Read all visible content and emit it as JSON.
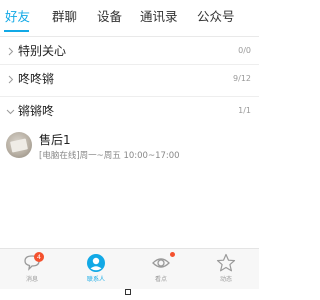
{
  "tabs": [
    {
      "label": "好友"
    },
    {
      "label": "群聊"
    },
    {
      "label": "设备"
    },
    {
      "label": "通讯录"
    },
    {
      "label": "公众号"
    }
  ],
  "groups": [
    {
      "name": "特别关心",
      "count": "0/0",
      "expanded": false
    },
    {
      "name": "咚咚锵",
      "count": "9/12",
      "expanded": false
    },
    {
      "name": "锵锵咚",
      "count": "1/1",
      "expanded": true
    }
  ],
  "friend": {
    "name": "售后1",
    "status_tag": "[电脑在线]",
    "status_text": "周一~周五 10:00~17:00"
  },
  "bottom_nav": [
    {
      "label": "消息",
      "icon": "message-icon",
      "badge": "4"
    },
    {
      "label": "联系人",
      "icon": "contacts-icon"
    },
    {
      "label": "看点",
      "icon": "eye-icon"
    },
    {
      "label": "动态",
      "icon": "star-icon"
    }
  ],
  "colors": {
    "accent": "#12a9e6",
    "badge": "#f4512e",
    "text": "#222222",
    "muted": "#999999"
  }
}
